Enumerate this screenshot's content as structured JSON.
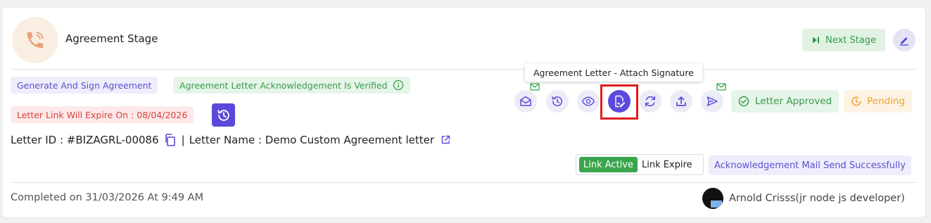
{
  "stage": {
    "title": "Agreement Stage",
    "icon": "phone-icon",
    "next_label": "Next Stage"
  },
  "badges": {
    "generate": "Generate And Sign Agreement",
    "ack_verified": "Agreement Letter Acknowledgement Is Verified",
    "expire": "Letter Link Will Expire On : 08/04/2026",
    "approved": "Letter Approved",
    "pending": "Pending",
    "mail_sent": "Acknowledgement Mail Send Successfully"
  },
  "tooltip": "Agreement Letter - Attach Signature",
  "actions": [
    {
      "name": "mail-open-icon"
    },
    {
      "name": "history-icon"
    },
    {
      "name": "eye-icon"
    },
    {
      "name": "attach-signature-icon",
      "active": true
    },
    {
      "name": "refresh-icon"
    },
    {
      "name": "upload-icon"
    },
    {
      "name": "send-icon"
    }
  ],
  "letter": {
    "id_label": "Letter ID : #BIZAGRL-00086",
    "separator": "|",
    "name_label": "Letter Name : Demo Custom Agreement letter"
  },
  "link_toggle": {
    "active": "Link Active",
    "expire": "Link Expire"
  },
  "footer": {
    "completed": "Completed on 31/03/2026 At 9:49 AM",
    "user": "Arnold Crisss(jr node js developer)"
  },
  "colors": {
    "accent": "#5b49dc",
    "success": "#3a9a4b",
    "danger": "#d7443e",
    "warning": "#efa032",
    "highlight": "#e21d1d"
  }
}
